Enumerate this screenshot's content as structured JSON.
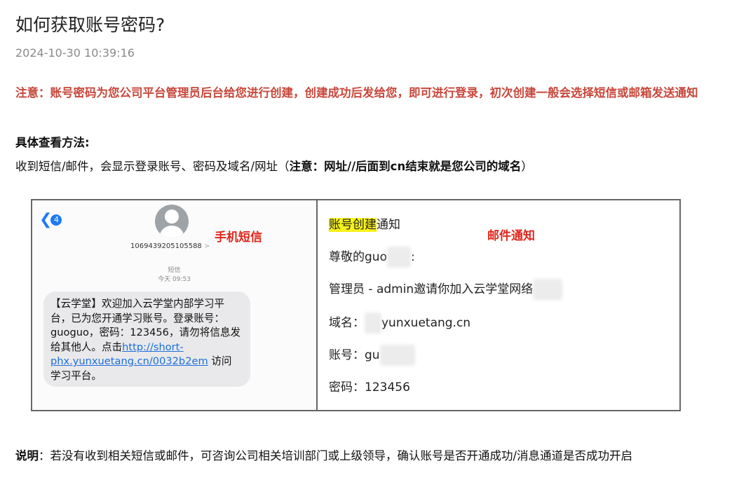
{
  "article": {
    "title": "如何获取账号密码?",
    "date": "2024-10-30 10:39:16",
    "notice": "注意：账号密码为您公司平台管理员后台给您进行创建，创建成功后发给您，即可进行登录，初次创建一般会选择短信或邮箱发送通知",
    "method_title": "具体查看方法:",
    "method_text": "收到短信/邮件，会显示登录账号、密码及域名/网址（",
    "method_bold": "注意：网址//后面到cn结束就是您公司的域名",
    "method_close": "）",
    "explain_label": "说明",
    "explain_text": "：若没有收到相关短信或邮件，可咨询公司相关培训部门或上级领导，确认账号是否开通成功/消息通道是否成功开启"
  },
  "sms": {
    "back_badge": "4",
    "sender": "1069439205105588",
    "sender_arrow": ">",
    "label": "手机短信",
    "kind": "短信",
    "time": "今天 09:53",
    "message": "【云学堂】欢迎加入云学堂内部学习平台，已为您开通学习账号。登录账号：guoguo，密码：123456，请勿将信息发给其他人。点击",
    "link": "http://short-phx.yunxuetang.cn/0032b2em",
    "message_tail": "访问学习平台。"
  },
  "email": {
    "label": "邮件通知",
    "subject_highlight": "账号创建",
    "subject_rest": "通知",
    "greeting": "尊敬的guo",
    "greeting_colon": ":",
    "admin_line": "管理员 - admin邀请你加入云学堂网络",
    "domain_label": "域名：",
    "domain_value": "yunxuetang.cn",
    "account_label": "账号：",
    "account_value": "gu",
    "password_label": "密码：",
    "password_value": "123456"
  },
  "colors": {
    "notice_red": "#c8473b",
    "label_red": "#e1261c",
    "link_blue": "#1e6fd9",
    "ios_blue": "#1e7bf2",
    "highlight_yellow": "#f7f21a"
  }
}
